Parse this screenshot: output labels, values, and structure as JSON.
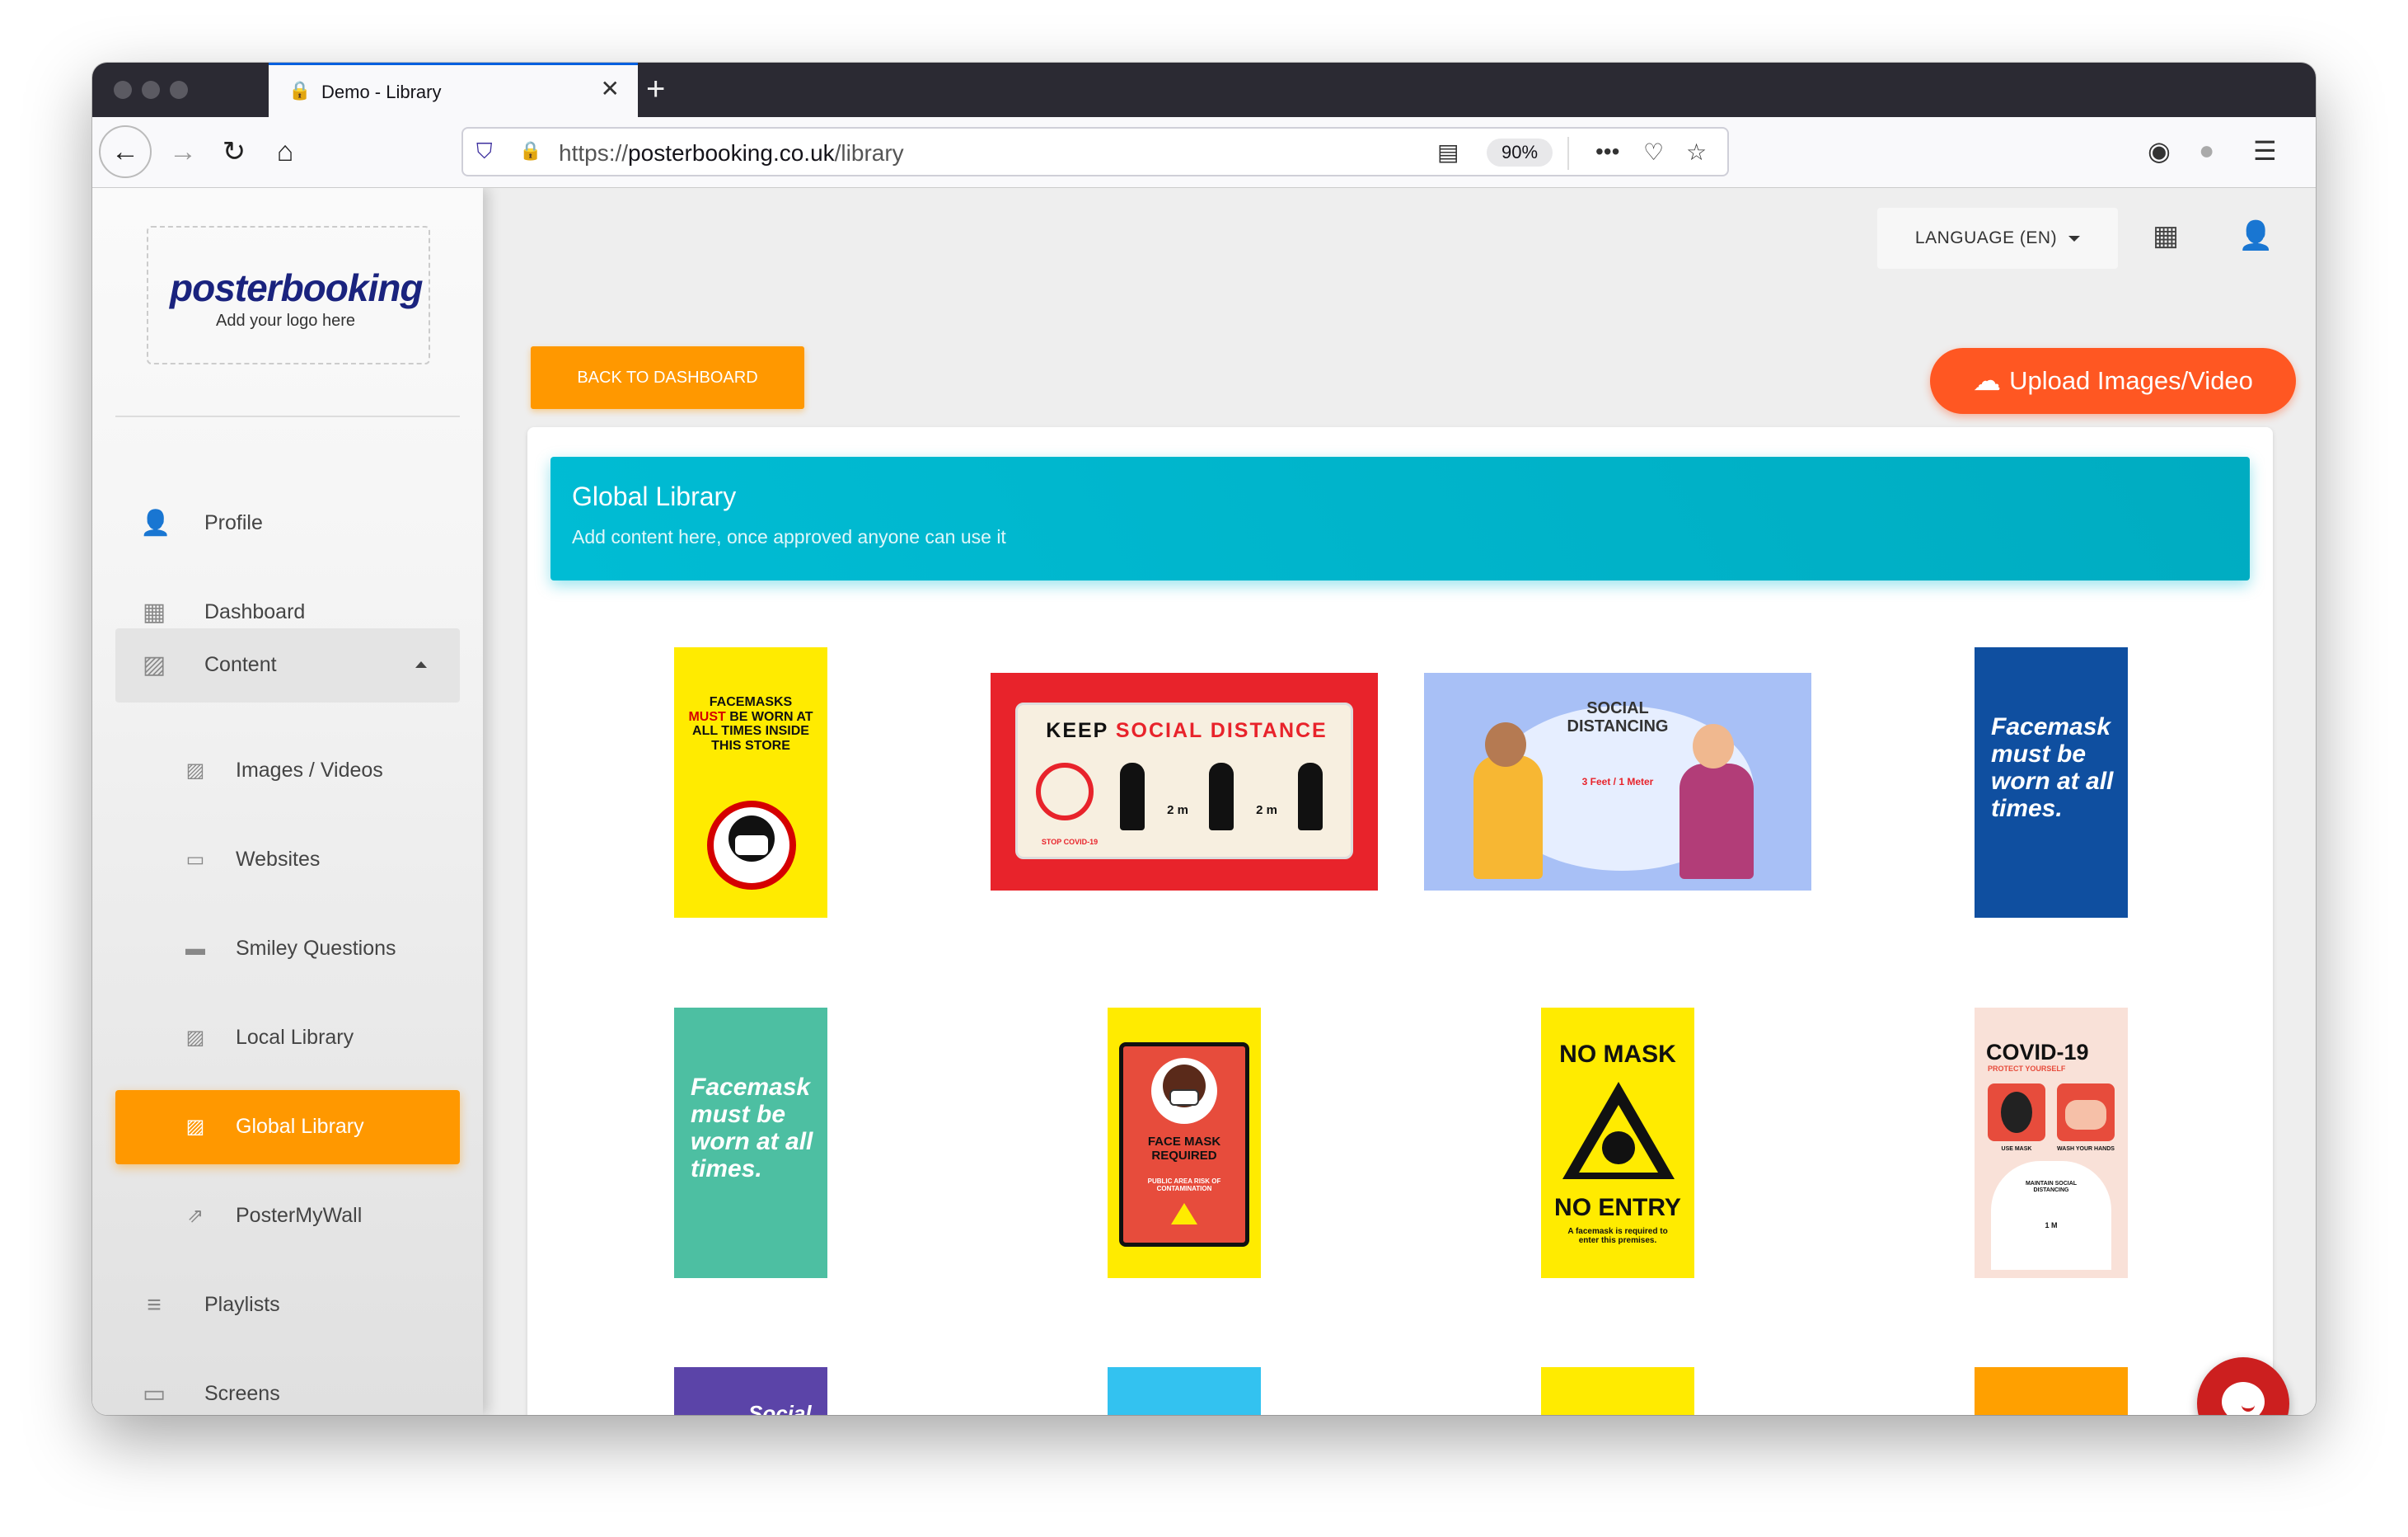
{
  "browser": {
    "tab_title": "Demo - Library",
    "new_tab": "+",
    "url_prefix": "https://",
    "url_host": "posterbooking.co.uk",
    "url_path": "/library",
    "zoom": "90%"
  },
  "sidebar": {
    "logo_word": "posterbooking",
    "logo_sub": "Add your logo here",
    "items": [
      {
        "label": "Profile",
        "icon": "person-icon"
      },
      {
        "label": "Dashboard",
        "icon": "dashboard-icon"
      },
      {
        "label": "Content",
        "icon": "image-icon"
      },
      {
        "label": "Images / Videos",
        "icon": "image-icon"
      },
      {
        "label": "Websites",
        "icon": "web-icon"
      },
      {
        "label": "Smiley Questions",
        "icon": "chat-icon"
      },
      {
        "label": "Local Library",
        "icon": "image-icon"
      },
      {
        "label": "Global Library",
        "icon": "image-icon"
      },
      {
        "label": "PosterMyWall",
        "icon": "external-link-icon"
      },
      {
        "label": "Playlists",
        "icon": "playlist-add-icon"
      },
      {
        "label": "Screens",
        "icon": "devices-icon"
      }
    ]
  },
  "header": {
    "language": "LANGUAGE (EN)",
    "back_to_dashboard": "BACK TO DASHBOARD",
    "upload": "Upload Images/Video"
  },
  "library": {
    "title": "Global Library",
    "subtitle": "Add content here, once approved anyone can use it"
  },
  "posters": {
    "p1_line1": "FACEMASKS",
    "p1_must": "MUST",
    "p1_line2": "BE WORN AT ALL TIMES INSIDE THIS STORE",
    "p2_keep": "KEEP",
    "p2_social": "SOCIAL DISTANCE",
    "p2_stop": "STOP COVID-19",
    "p2_dist": "2 m",
    "p3_title": "SOCIAL DISTANCING",
    "p3_dist": "3 Feet / 1 Meter",
    "p4_text": "Facemask must be worn at all times.",
    "p5_text": "Facemask must be worn at all times.",
    "p6_title": "FACE MASK REQUIRED",
    "p6_sub": "PUBLIC AREA RISK OF CONTAMINATION",
    "p7_top": "NO MASK",
    "p7_bottom": "NO ENTRY",
    "p7_small": "A facemask is required to enter this premises.",
    "p8_title": "COVID-19",
    "p8_sub": "PROTECT YOURSELF",
    "p8_a": "USE MASK",
    "p8_b": "WASH YOUR HANDS",
    "p8_c": "MAINTAIN SOCIAL DISTANCING",
    "p8_d": "1 M",
    "p9_text": "Social"
  },
  "colors": {
    "accent_orange": "#ff9800",
    "upload_orange": "#ff5722",
    "header_cyan": "#00bcd4",
    "chat_red": "#cc1f1f"
  }
}
